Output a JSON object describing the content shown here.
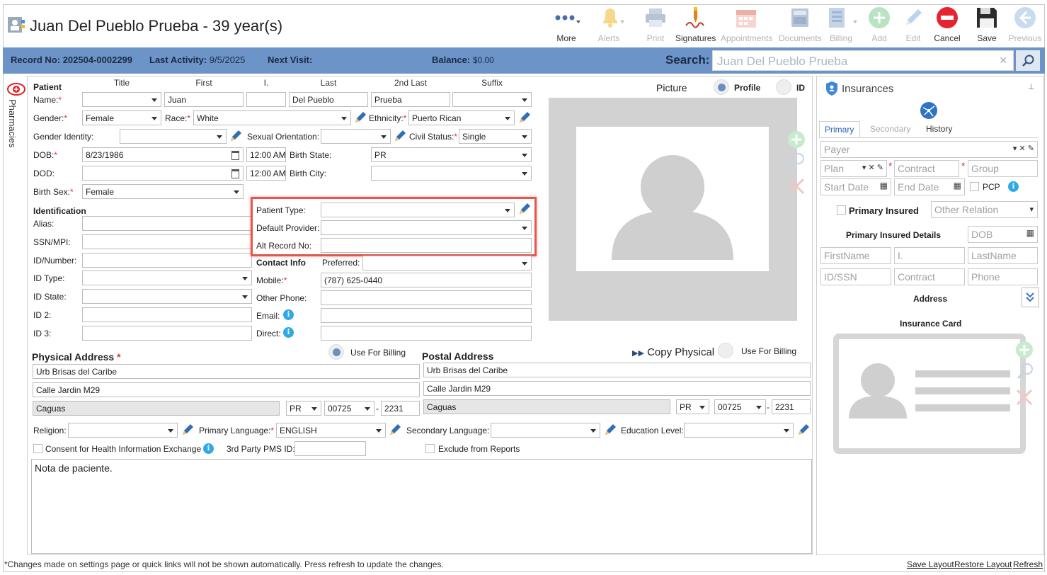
{
  "window": {
    "title": "Juan Del Pueblo Prueba - 39 year(s)"
  },
  "toolbar": {
    "more": "More",
    "alerts": "Alerts",
    "print": "Print",
    "signatures": "Signatures",
    "appointments": "Appointments",
    "documents": "Documents",
    "billing": "Billing",
    "add": "Add",
    "edit": "Edit",
    "cancel": "Cancel",
    "save": "Save",
    "previous": "Previous"
  },
  "infobar": {
    "record_label": "Record No:",
    "record_value": "202504-0002299",
    "activity_label": "Last Activity:",
    "activity_value": "9/5/2025",
    "next_visit_label": "Next Visit:",
    "balance_label": "Balance:",
    "balance_value": "$0.00",
    "search_label": "Search:",
    "search_value": "Juan Del Pueblo Prueba"
  },
  "sidebar": {
    "pharmacies": "Pharmacies"
  },
  "patient": {
    "section": "Patient",
    "col_title": "Title",
    "col_first": "First",
    "col_initial": "I.",
    "col_last": "Last",
    "col_2nd_last": "2nd Last",
    "col_suffix": "Suffix",
    "name_label": "Name:",
    "first": "Juan",
    "last": "Del Pueblo",
    "second_last": "Prueba",
    "gender_label": "Gender:",
    "gender": "Female",
    "race_label": "Race:",
    "race": "White",
    "ethnicity_label": "Ethnicity:",
    "ethnicity": "Puerto Rican",
    "gender_identity_label": "Gender Identity:",
    "sexual_orientation_label": "Sexual Orientation:",
    "civil_status_label": "Civil Status:",
    "civil_status": "Single",
    "dob_label": "DOB:",
    "dob": "8/23/1986",
    "dob_time": "12:00 AM",
    "birth_state_label": "Birth State:",
    "birth_state": "PR",
    "dod_label": "DOD:",
    "dod_time": "12:00 AM",
    "birth_city_label": "Birth City:",
    "birth_sex_label": "Birth Sex:",
    "birth_sex": "Female"
  },
  "identification": {
    "section": "Identification",
    "alias": "Alias:",
    "ssn": "SSN/MPI:",
    "id_number": "ID/Number:",
    "id_type": "ID Type:",
    "id_state": "ID State:",
    "id2": "ID 2:",
    "id3": "ID 3:"
  },
  "highlighted": {
    "patient_type": "Patient Type:",
    "default_provider": "Default Provider:",
    "alt_record": "Alt Record No:"
  },
  "contact": {
    "section": "Contact Info",
    "preferred_label": "Preferred:",
    "mobile_label": "Mobile:",
    "mobile": "(787) 625-0440",
    "other_phone_label": "Other Phone:",
    "email_label": "Email:",
    "direct_label": "Direct:"
  },
  "picture": {
    "label": "Picture",
    "profile": "Profile",
    "id": "ID"
  },
  "physical_address": {
    "section": "Physical Address",
    "use_for_billing": "Use For Billing",
    "line1": "Urb Brisas del Caribe",
    "line2": "Calle Jardin M29",
    "city": "Caguas",
    "state": "PR",
    "zip": "00725",
    "zip4": "2231"
  },
  "postal_address": {
    "section": "Postal Address",
    "copy_physical": "Copy Physical",
    "use_for_billing": "Use For Billing",
    "line1": "Urb Brisas del Caribe",
    "line2": "Calle Jardin M29",
    "city": "Caguas",
    "state": "PR",
    "zip": "00725",
    "zip4": "2231"
  },
  "misc": {
    "religion_label": "Religion:",
    "primary_language_label": "Primary Language:",
    "primary_language": "ENGLISH",
    "secondary_language_label": "Secondary Language:",
    "education_label": "Education Level:",
    "consent_label": "Consent for Health Information Exchange",
    "pms_label": "3rd Party PMS ID:",
    "exclude_label": "Exclude from Reports"
  },
  "note": {
    "text": "Nota de paciente."
  },
  "insurances": {
    "title": "Insurances",
    "tabs": [
      "Primary",
      "Secondary",
      "History"
    ],
    "payer": "Payer",
    "plan": "Plan",
    "contract": "Contract",
    "group": "Group",
    "start_date": "Start Date",
    "end_date": "End Date",
    "pcp": "PCP",
    "primary_insured": "Primary Insured",
    "other_relation": "Other Relation",
    "insured_details": "Primary Insured Details",
    "dob": "DOB",
    "firstname": "FirstName",
    "initial": "I.",
    "lastname": "LastName",
    "id_ssn": "ID/SSN",
    "contract2": "Contract",
    "phone": "Phone",
    "address": "Address",
    "card": "Insurance Card"
  },
  "footer": {
    "notice": "*Changes made on settings page or quick links will not be shown automatically. Press refresh to update the changes.",
    "save_layout": "Save Layout",
    "restore_layout": "Restore Layout",
    "refresh": "Refresh"
  },
  "colors": {
    "accent": "#6c94c9",
    "highlight": "#e4574e",
    "required": "#dd3333",
    "info": "#2fa8e6"
  }
}
